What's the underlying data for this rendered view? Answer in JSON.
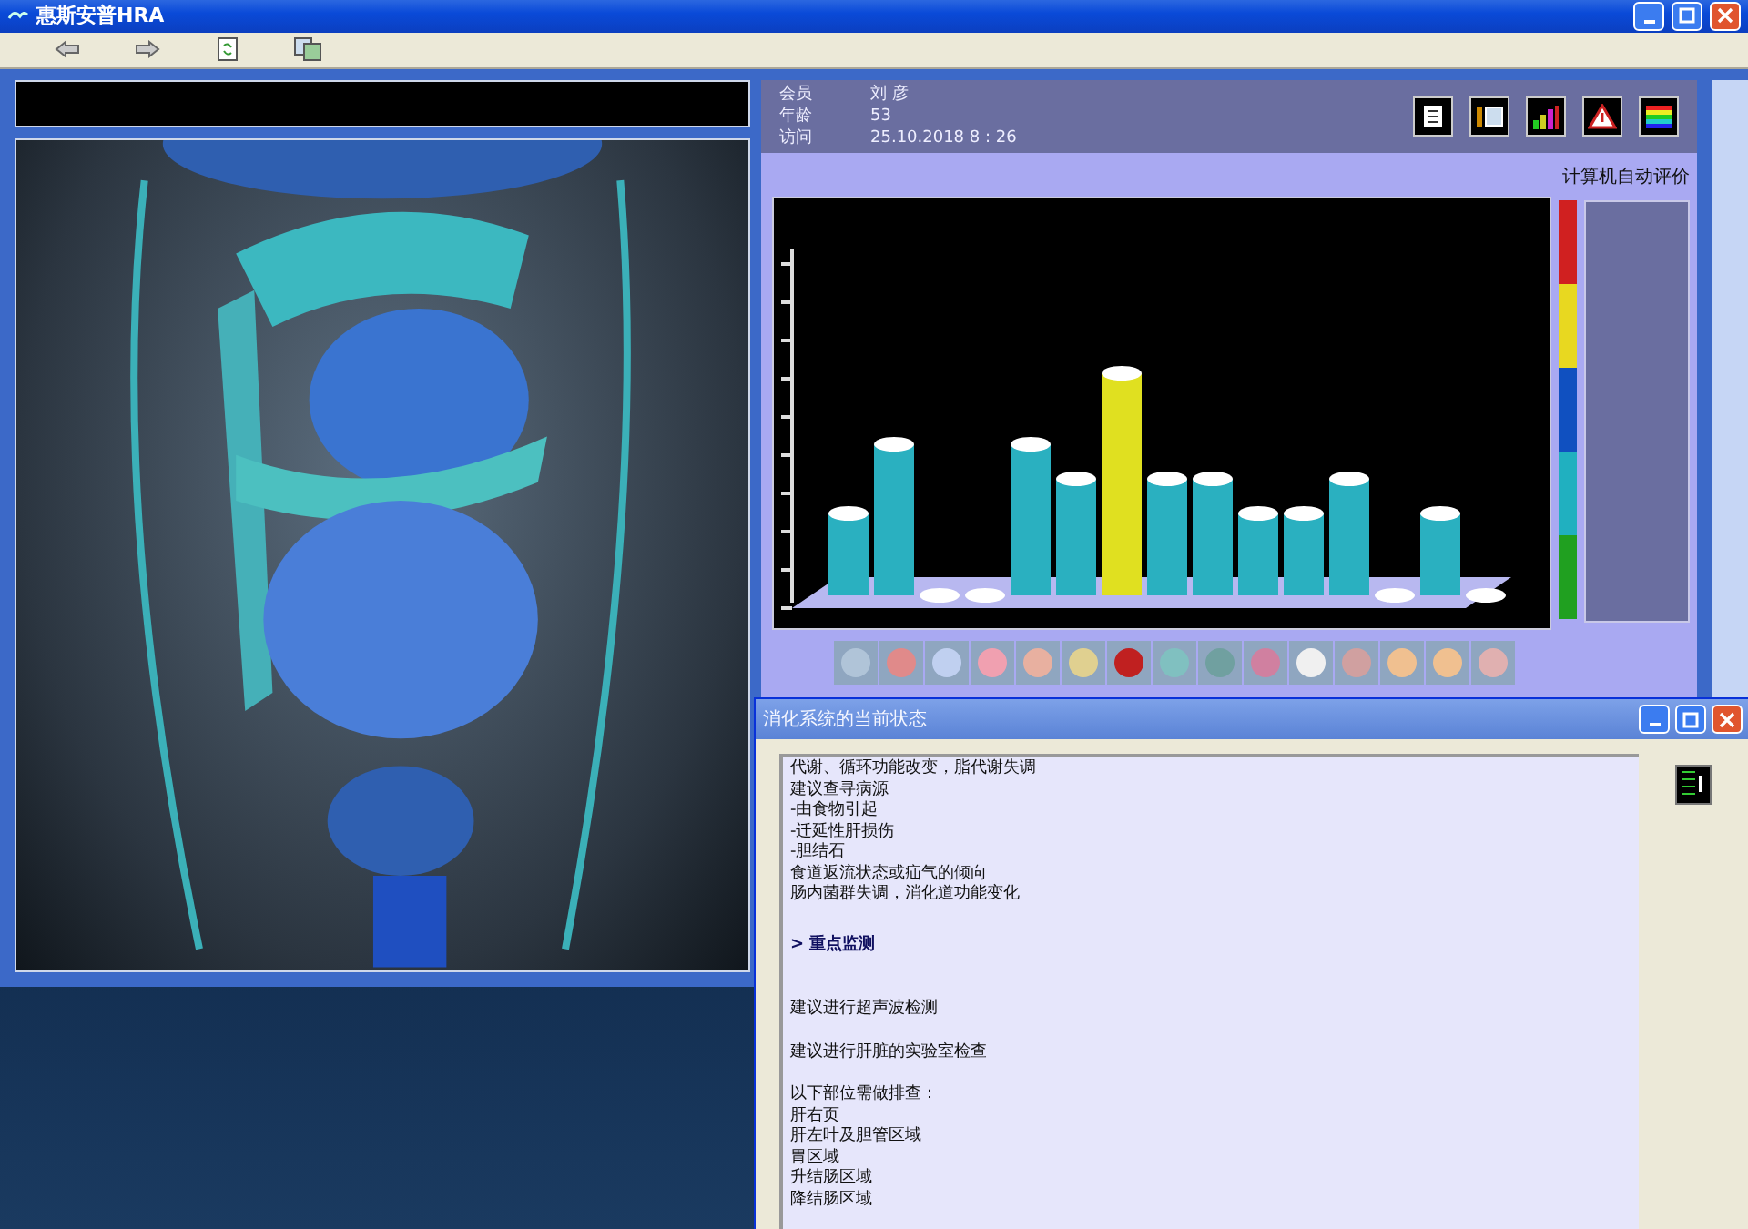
{
  "window": {
    "title": "惠斯安普HRA"
  },
  "patient": {
    "fields": [
      {
        "label": "会员",
        "value": "刘 彦"
      },
      {
        "label": "年龄",
        "value": "53"
      },
      {
        "label": "访问",
        "value": "25.10.2018  8 : 26"
      }
    ]
  },
  "evaluation_label": "计算机自动评价",
  "dialog": {
    "title": "消化系统的当前状态",
    "paragraphs": [
      {
        "kind": "text",
        "lines": [
          "代谢、循环功能改变，脂代谢失调",
          "建议查寻病源",
          "-由食物引起",
          "-迁延性肝损伤",
          "-胆结石",
          "食道返流状态或疝气的倾向",
          "肠内菌群失调，消化道功能变化"
        ]
      },
      {
        "kind": "heading",
        "lines": [
          "> 重点监测"
        ]
      },
      {
        "kind": "text",
        "lines": [
          "建议进行超声波检测"
        ]
      },
      {
        "kind": "text",
        "lines": [
          "建议进行肝脏的实验室检查"
        ]
      },
      {
        "kind": "text",
        "lines": [
          "以下部位需做排查：",
          "肝右页",
          "肝左叶及胆管区域",
          "胃区域",
          "升结肠区域",
          "降结肠区域"
        ]
      }
    ]
  }
}
